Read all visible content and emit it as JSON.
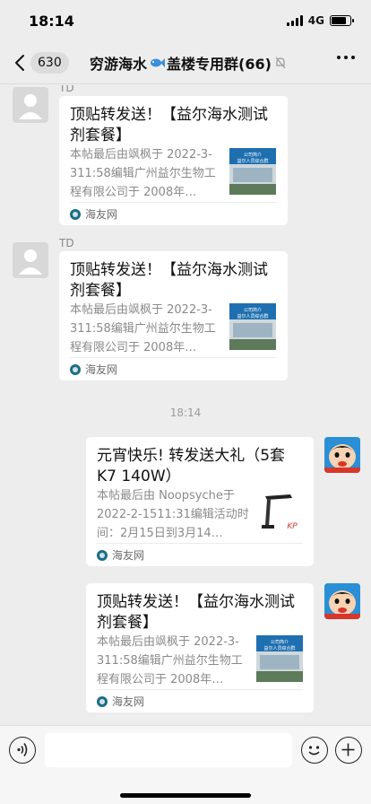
{
  "status": {
    "time": "18:14",
    "network": "4G",
    "battery_level": 0.8
  },
  "header": {
    "unread_count": "630",
    "title_part1": "穷游海水",
    "title_part2": "盖楼专用群(66)",
    "icons": [
      "back-icon",
      "fish-icon",
      "mute-icon",
      "more-icon"
    ]
  },
  "messages": [
    {
      "sender": "TD",
      "title_line1": "顶贴转发送！【益尔海水测试",
      "title_line2": "剂套餐】",
      "desc": "本帖最后由飒枫于 2022-3-311:58编辑广州益尔生物工程有限公司于 2008年…",
      "source": "海友网"
    },
    {
      "sender": "TD",
      "title_line1": "顶贴转发送！【益尔海水测试",
      "title_line2": "剂套餐】",
      "desc": "本帖最后由飒枫于 2022-3-311:58编辑广州益尔生物工程有限公司于 2008年…",
      "source": "海友网"
    },
    {
      "title_line1": "元宵快乐! 转发送大礼（5套",
      "title_line2": "K7  140W）",
      "desc": "本帖最后由 Noopsyche于 2022-2-1511:31编辑活动时间：2月15日到3月14…",
      "source": "海友网"
    },
    {
      "title_line1": "顶贴转发送！【益尔海水测试",
      "title_line2": "剂套餐】",
      "desc": "本帖最后由飒枫于 2022-3-311:58编辑广州益尔生物工程有限公司于 2008年…",
      "source": "海友网"
    }
  ],
  "timestamp": "18:14",
  "thumb_text": "公司简介 益尔人员综合群",
  "colors": {
    "bg": "#ededed",
    "card": "#ffffff",
    "meta": "#8a8a8a"
  }
}
